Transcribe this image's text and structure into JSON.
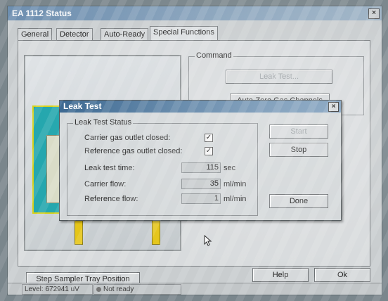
{
  "window": {
    "title": "EA 1112 Status",
    "close_glyph": "×"
  },
  "tabs": [
    {
      "label": "General"
    },
    {
      "label": "Detector"
    },
    {
      "label": "Auto-Ready"
    },
    {
      "label": "Special Functions",
      "active": true
    }
  ],
  "command": {
    "group_label": "Command",
    "leak_test_button": "Leak Test...",
    "auto_zero_button": "Auto-Zero Gas Channels"
  },
  "footer": {
    "step_sampler_button": "Step Sampler Tray Position",
    "help_button": "Help",
    "ok_button": "Ok"
  },
  "statusbar": {
    "level": "Level: 672941 uV",
    "ready": "Not ready"
  },
  "dialog": {
    "title": "Leak Test",
    "close_glyph": "×",
    "group_label": "Leak Test Status",
    "carrier_outlet_label": "Carrier gas outlet closed:",
    "carrier_outlet_checked": true,
    "reference_outlet_label": "Reference gas outlet closed:",
    "reference_outlet_checked": true,
    "check_glyph": "✓",
    "leak_time_label": "Leak test time:",
    "leak_time_value": "115",
    "leak_time_unit": "sec",
    "carrier_flow_label": "Carrier flow:",
    "carrier_flow_value": "35",
    "carrier_flow_unit": "ml/min",
    "reference_flow_label": "Reference flow:",
    "reference_flow_value": "1",
    "reference_flow_unit": "ml/min",
    "start_button": "Start",
    "stop_button": "Stop",
    "done_button": "Done"
  },
  "colors": {
    "titlebar": "#6e8fb0",
    "dialog_titlebar": "#3a6790",
    "instrument_body": "#25a7ae",
    "instrument_legs": "#e5c519"
  }
}
